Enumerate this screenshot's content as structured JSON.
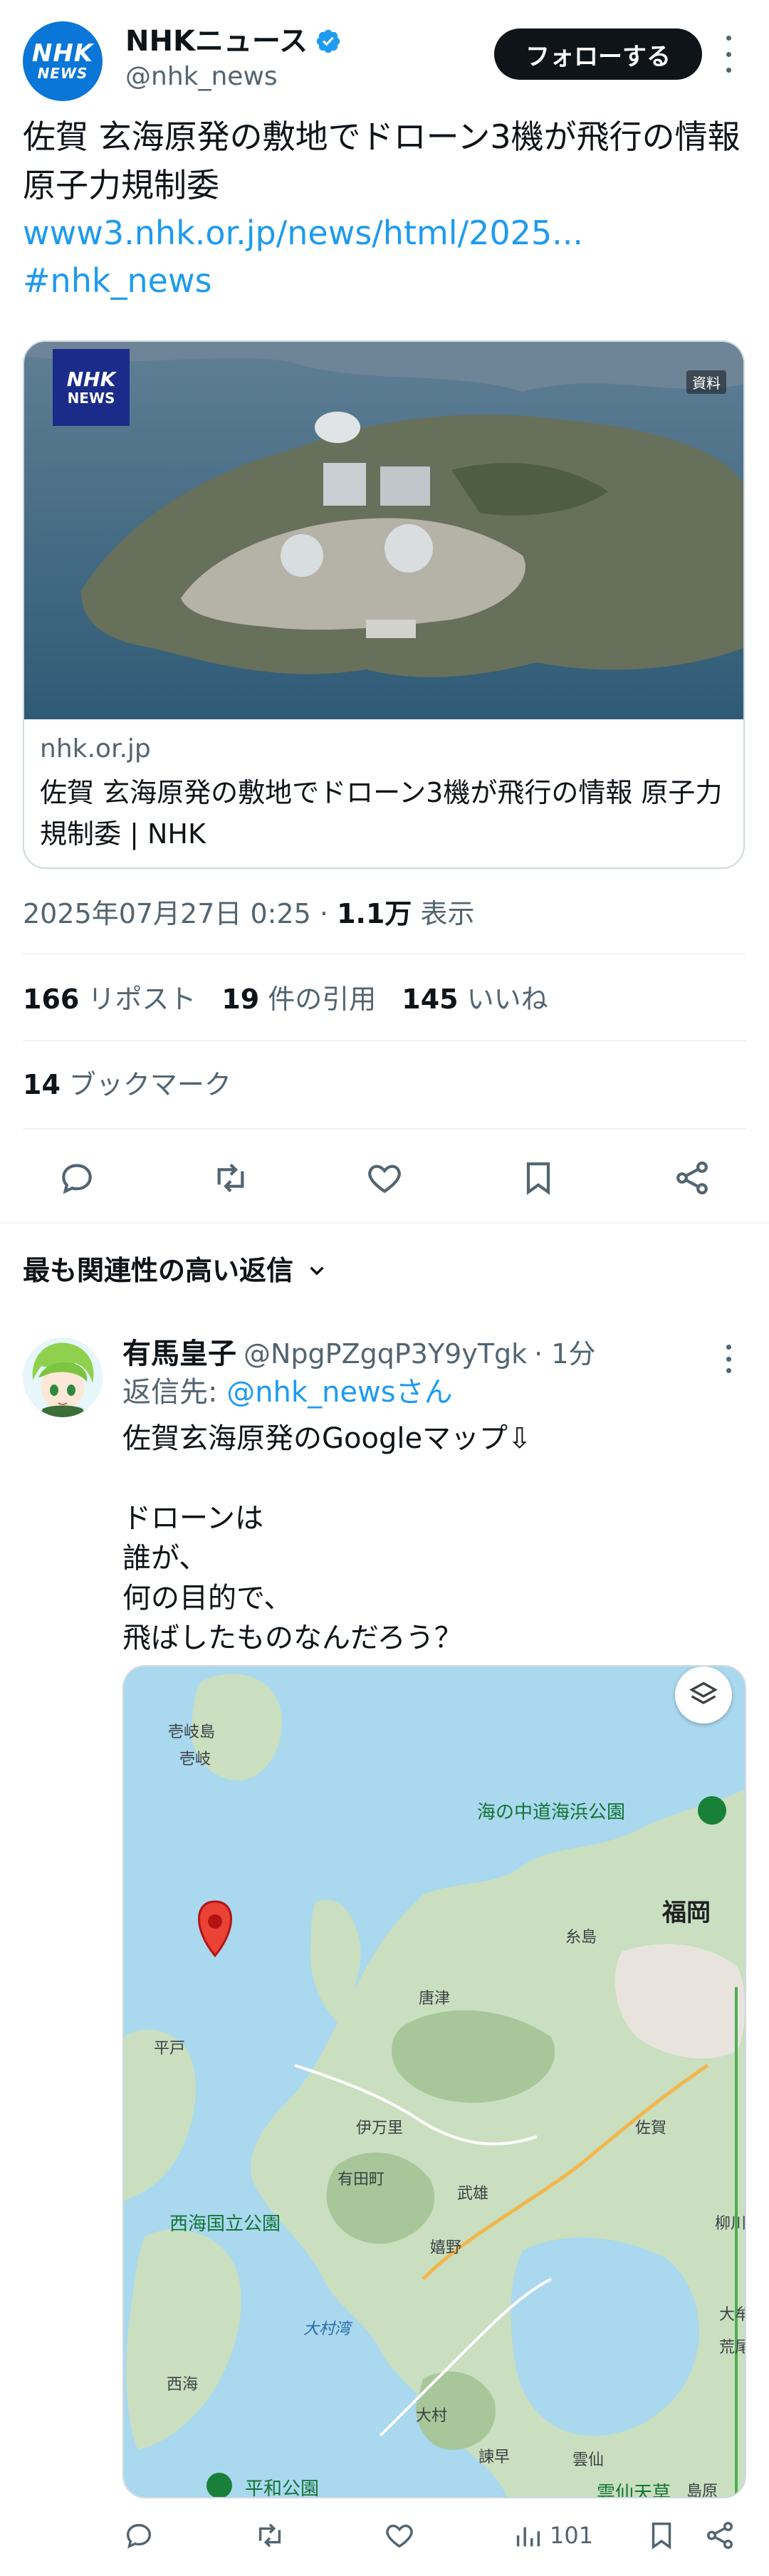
{
  "author": {
    "avatar_line1": "NHK",
    "avatar_line2": "NEWS",
    "name": "NHKニュース",
    "handle": "@nhk_news",
    "follow_label": "フォローする"
  },
  "tweet": {
    "text": "佐賀 玄海原発の敷地でドローン3機が飛行の情報 原子力規制委",
    "link": "www3.nhk.or.jp/news/html/2025...",
    "hashtag": "#nhk_news"
  },
  "card": {
    "badge_line1": "NHK",
    "badge_line2": "NEWS",
    "tag": "資料",
    "domain": "nhk.or.jp",
    "title": "佐賀 玄海原発の敷地でドローン3機が飛行の情報 原子力規制委 | NHK"
  },
  "meta": {
    "timestamp": "2025年07月27日 0:25 · ",
    "views_count": "1.1万",
    "views_label": " 表示"
  },
  "stats": {
    "reposts_count": "166",
    "reposts_label": "リポスト",
    "quotes_count": "19",
    "quotes_label": "件の引用",
    "likes_count": "145",
    "likes_label": "いいね",
    "bookmarks_count": "14",
    "bookmarks_label": "ブックマーク"
  },
  "icons": [
    "reply-icon",
    "repost-icon",
    "like-icon",
    "bookmark-icon",
    "share-icon",
    "verified-icon",
    "chevron-down-icon",
    "layers-icon",
    "map-pin-icon",
    "views-icon"
  ],
  "relevant_label": "最も関連性の高い返信",
  "reply": {
    "name": "有馬皇子",
    "handle": "@NpgPZgqP3Y9yTgk",
    "time": "· 1分",
    "reply_to_prefix": "返信先: ",
    "reply_to_handle": "@nhk_newsさん",
    "body": "佐賀玄海原発のGoogleマップ⇩\n\nドローンは\n誰が、\n何の目的で、\n飛ばしたものなんだろう？",
    "views": "101"
  },
  "map": {
    "labels": {
      "iki": "壱岐島",
      "iki_city": "壱岐",
      "uminonaka": "海の中道海浜公園",
      "fukuoka": "福岡",
      "itoshima": "糸島",
      "karatsu": "唐津",
      "hirado": "平戸",
      "imari": "伊万里",
      "arita": "有田町",
      "saga": "佐賀",
      "saikai": "西海国立公園",
      "takeo": "武雄",
      "yanagawa": "柳川",
      "ureshino": "嬉野",
      "omura_bay": "大村湾",
      "omuta": "大牟",
      "arao": "荒尾",
      "saikai_city": "西海",
      "omura": "大村",
      "isahaya": "諫早",
      "unzen": "雲仙",
      "heiwa": "平和公園",
      "unzen_amakusa": "雲仙天草",
      "shimabara": "島原"
    }
  },
  "colors": {
    "accent": "#1d9bf0",
    "text": "#0f1419",
    "muted": "#536471",
    "nhk_blue": "#0a76d8",
    "sea": "#a9d8ef",
    "land": "#c9dfc0"
  }
}
